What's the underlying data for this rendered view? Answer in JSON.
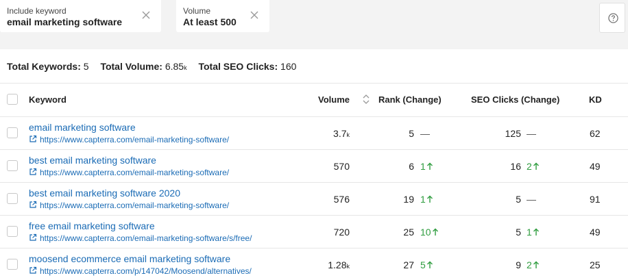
{
  "filters": [
    {
      "label": "Include keyword",
      "value": "email marketing software"
    },
    {
      "label": "Volume",
      "value": "At least 500"
    }
  ],
  "totals": {
    "keywords_label": "Total Keywords:",
    "keywords_value": "5",
    "volume_label": "Total Volume:",
    "volume_value": "6.85",
    "volume_unit": "k",
    "clicks_label": "Total SEO Clicks:",
    "clicks_value": "160"
  },
  "table": {
    "headers": {
      "keyword": "Keyword",
      "volume": "Volume",
      "rank": "Rank (Change)",
      "clicks": "SEO Clicks (Change)",
      "kd": "KD"
    },
    "rows": [
      {
        "keyword": "email marketing software",
        "url": "https://www.capterra.com/email-marketing-software/",
        "volume": "3.7",
        "volume_unit": "k",
        "rank": "5",
        "rank_change": "—",
        "rank_dir": "none",
        "clicks": "125",
        "clicks_change": "—",
        "clicks_dir": "none",
        "kd": "62"
      },
      {
        "keyword": "best email marketing software",
        "url": "https://www.capterra.com/email-marketing-software/",
        "volume": "570",
        "volume_unit": "",
        "rank": "6",
        "rank_change": "1",
        "rank_dir": "up",
        "clicks": "16",
        "clicks_change": "2",
        "clicks_dir": "up",
        "kd": "49"
      },
      {
        "keyword": "best email marketing software 2020",
        "url": "https://www.capterra.com/email-marketing-software/",
        "volume": "576",
        "volume_unit": "",
        "rank": "19",
        "rank_change": "1",
        "rank_dir": "up",
        "clicks": "5",
        "clicks_change": "—",
        "clicks_dir": "none",
        "kd": "91"
      },
      {
        "keyword": "free email marketing software",
        "url": "https://www.capterra.com/email-marketing-software/s/free/",
        "volume": "720",
        "volume_unit": "",
        "rank": "25",
        "rank_change": "10",
        "rank_dir": "up",
        "clicks": "5",
        "clicks_change": "1",
        "clicks_dir": "up",
        "kd": "49"
      },
      {
        "keyword": "moosend ecommerce email marketing software",
        "url": "https://www.capterra.com/p/147042/Moosend/alternatives/",
        "volume": "1.28",
        "volume_unit": "k",
        "rank": "27",
        "rank_change": "5",
        "rank_dir": "up",
        "clicks": "9",
        "clicks_change": "2",
        "clicks_dir": "up",
        "kd": "25"
      }
    ]
  },
  "colors": {
    "link": "#1a6bb5",
    "up": "#2e9c3e",
    "filter_bg": "#f3f3f3"
  }
}
